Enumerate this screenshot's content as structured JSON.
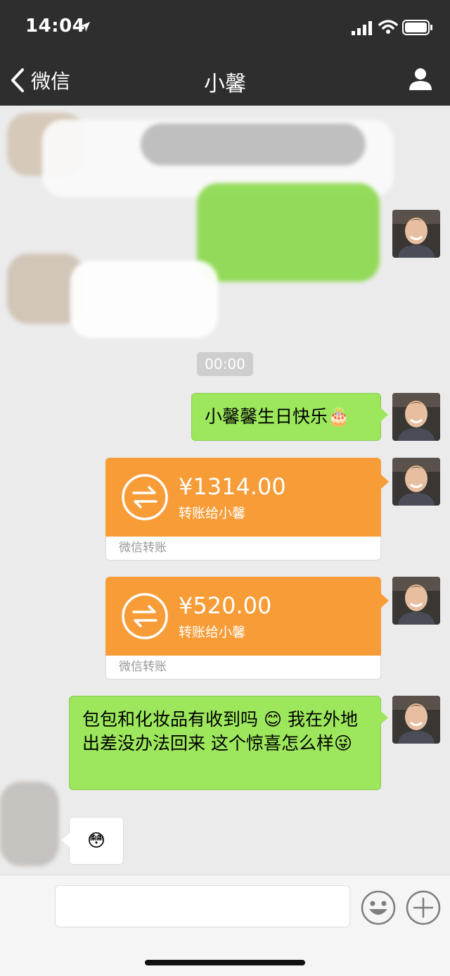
{
  "status_bar": {
    "time": "14:04"
  },
  "nav": {
    "back_label": "微信",
    "title": "小馨"
  },
  "chat": {
    "timestamp": "00:00",
    "messages": [
      {
        "type": "text",
        "side": "right",
        "text": "小馨馨生日快乐🎂"
      },
      {
        "type": "transfer",
        "side": "right",
        "amount": "¥1314.00",
        "note": "转账给小馨",
        "footer": "微信转账"
      },
      {
        "type": "transfer",
        "side": "right",
        "amount": "¥520.00",
        "note": "转账给小馨",
        "footer": "微信转账"
      },
      {
        "type": "text",
        "side": "right",
        "text": "包包和化妆品有收到吗 😊 我在外地出差没办法回来 这个惊喜怎么样😜"
      },
      {
        "type": "text",
        "side": "left",
        "text": "😳"
      }
    ]
  },
  "input_bar": {
    "placeholder": ""
  },
  "colors": {
    "nav_bg": "#2e2e2e",
    "chat_bg": "#ebebeb",
    "bubble_green": "#9de75c",
    "transfer_orange": "#f79c37"
  },
  "icons": [
    "location-arrow-icon",
    "signal-icon",
    "wifi-icon",
    "battery-icon",
    "back-chevron-icon",
    "profile-icon",
    "transfer-icon",
    "emoji-icon",
    "plus-icon"
  ]
}
